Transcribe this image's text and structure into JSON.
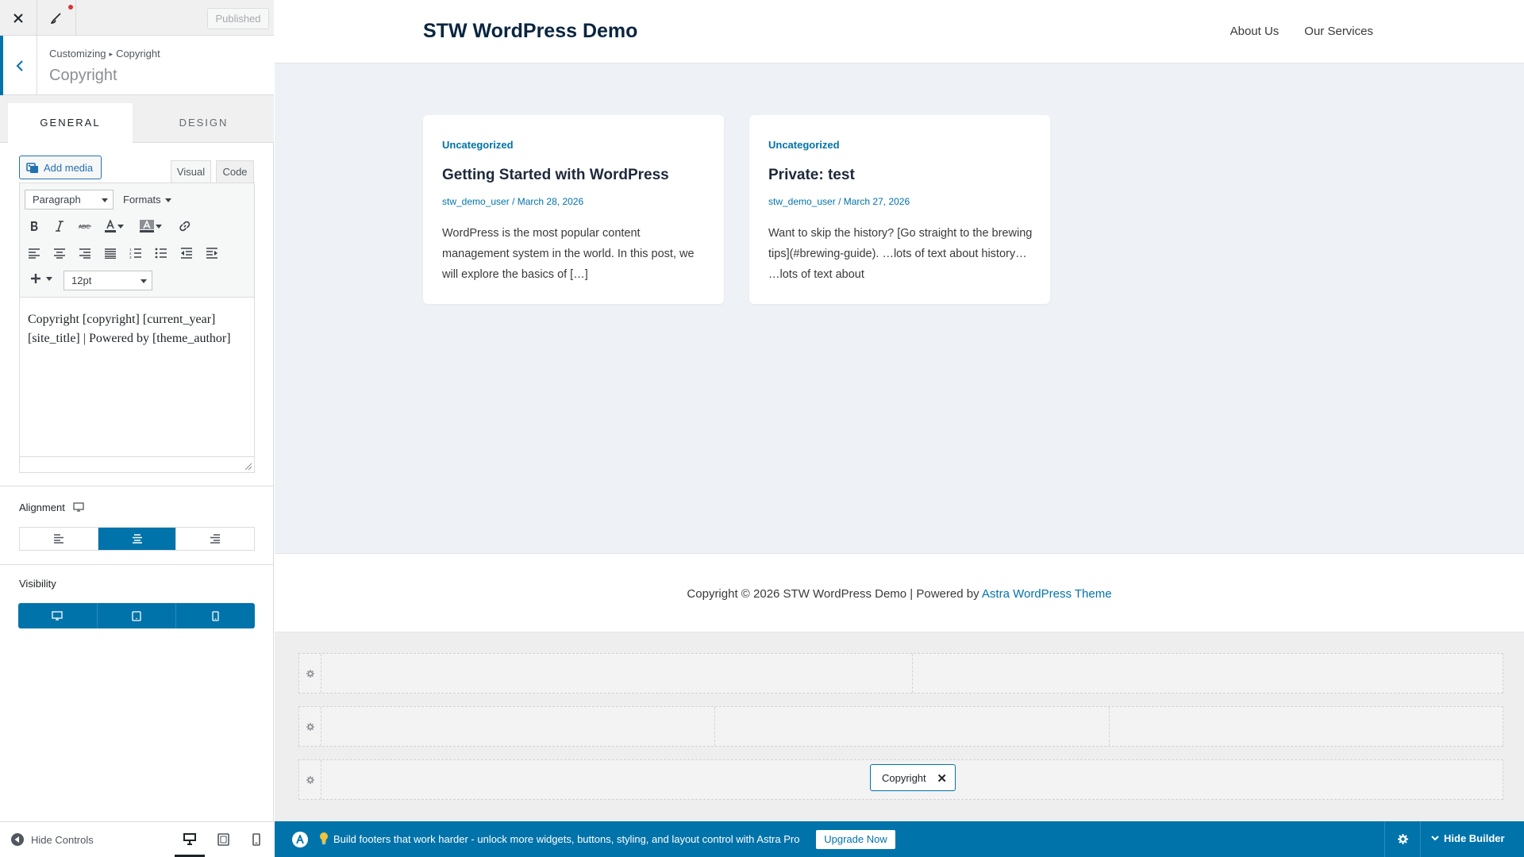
{
  "customizer": {
    "published_label": "Published",
    "breadcrumb_root": "Customizing",
    "breadcrumb_separator": "▸",
    "breadcrumb_current": "Copyright",
    "section_title": "Copyright",
    "tabs": [
      {
        "label": "GENERAL",
        "active": true
      },
      {
        "label": "DESIGN",
        "active": false
      }
    ],
    "editor": {
      "add_media_label": "Add media",
      "mode_tabs": [
        "Visual",
        "Code"
      ],
      "format_select_value": "Paragraph",
      "formats_menu_label": "Formats",
      "font_size_value": "12pt",
      "content": "Copyright [copyright] [current_year] [site_title] | Powered by [theme_author]"
    },
    "alignment": {
      "label": "Alignment",
      "options": [
        "left",
        "center",
        "right"
      ],
      "selected": "center"
    },
    "visibility": {
      "label": "Visibility",
      "devices": [
        "desktop",
        "tablet",
        "mobile"
      ]
    },
    "footer": {
      "hide_controls_label": "Hide Controls",
      "preview_device": "desktop"
    }
  },
  "preview": {
    "site_title": "STW WordPress Demo",
    "nav": [
      "About Us",
      "Our Services"
    ],
    "posts": [
      {
        "category": "Uncategorized",
        "title": "Getting Started with WordPress",
        "author": "stw_demo_user",
        "meta_separator": "/",
        "date": "March 28, 2026",
        "excerpt": "WordPress is the most popular content management system in the world. In this post, we will explore the basics of […]"
      },
      {
        "category": "Uncategorized",
        "title": "Private: test",
        "author": "stw_demo_user",
        "meta_separator": "/",
        "date": "March 27, 2026",
        "excerpt": "Want to skip the history? [Go straight to the brewing tips](#brewing-guide). …lots of text about history… …lots of text about"
      }
    ],
    "footer_text": "Copyright © 2026 STW WordPress Demo | Powered by ",
    "footer_link": "Astra WordPress Theme"
  },
  "builder": {
    "element_chip": "Copyright",
    "chip_remove_glyph": "✕"
  },
  "bottom_bar": {
    "promo_text": "Build footers that work harder - unlock more widgets, buttons, styling, and layout control with Astra Pro",
    "upgrade_label": "Upgrade Now",
    "hide_builder_label": "Hide Builder"
  },
  "colors": {
    "accent": "#0073aa",
    "site_title": "#0a2540",
    "preview_bg": "#eef1f5"
  }
}
